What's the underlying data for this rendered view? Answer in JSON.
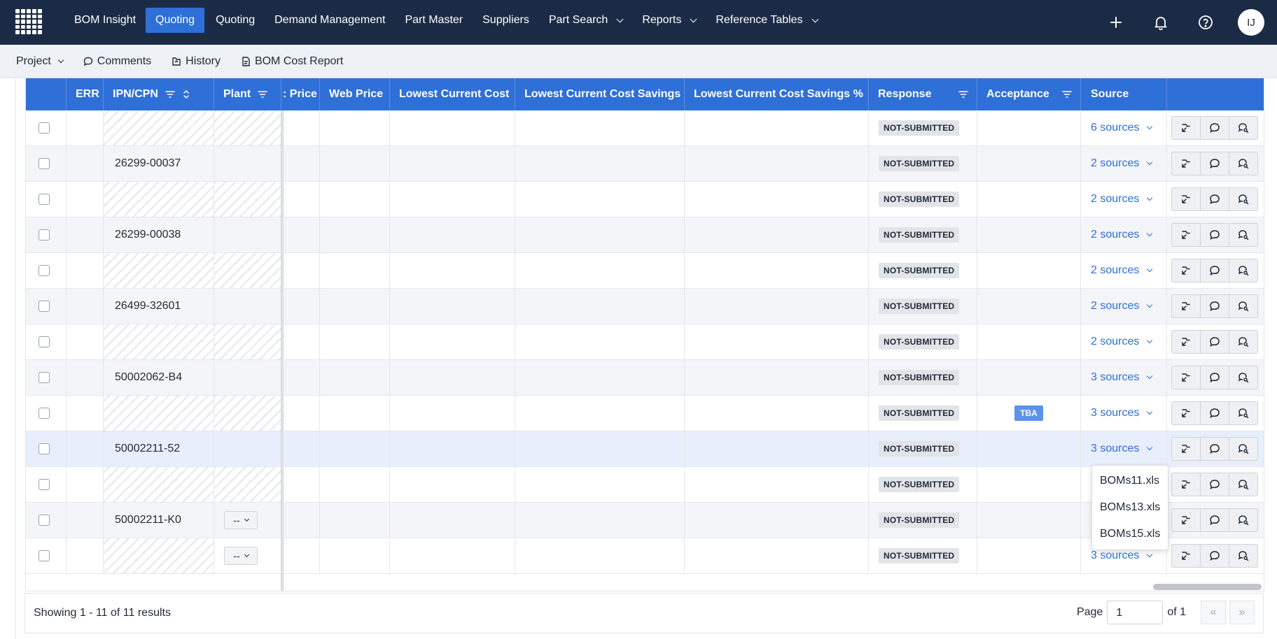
{
  "nav": {
    "items": [
      {
        "label": "BOM Insight",
        "active": false,
        "has_menu": false
      },
      {
        "label": "Quoting",
        "active": true,
        "has_menu": false
      },
      {
        "label": "Quoting",
        "active": false,
        "has_menu": false
      },
      {
        "label": "Demand Management",
        "active": false,
        "has_menu": false
      },
      {
        "label": "Part Master",
        "active": false,
        "has_menu": false
      },
      {
        "label": "Suppliers",
        "active": false,
        "has_menu": false
      },
      {
        "label": "Part Search",
        "active": false,
        "has_menu": true
      },
      {
        "label": "Reports",
        "active": false,
        "has_menu": true
      },
      {
        "label": "Reference Tables",
        "active": false,
        "has_menu": true
      }
    ],
    "avatar_initials": "IJ",
    "icons": [
      "plus-icon",
      "bell-icon",
      "help-icon"
    ]
  },
  "subnav": {
    "project": "Project",
    "comments": "Comments",
    "history": "History",
    "bom_cost_report": "BOM Cost Report"
  },
  "table": {
    "headers": {
      "err": "ERR",
      "ipn": "IPN/CPN",
      "plant": "Plant",
      "price": ": Price",
      "web_price": "Web Price",
      "lowest_cost": "Lowest Current Cost",
      "lowest_savings": "Lowest Current Cost Savings",
      "lowest_savings_pct": "Lowest Current Cost Savings %",
      "response": "Response",
      "acceptance": "Acceptance",
      "source": "Source"
    },
    "rows": [
      {
        "ipn": "",
        "plant": "",
        "response": "NOT-SUBMITTED",
        "acceptance": "",
        "source": "6 sources"
      },
      {
        "ipn": "26299-00037",
        "plant": "",
        "response": "NOT-SUBMITTED",
        "acceptance": "",
        "source": "2 sources"
      },
      {
        "ipn": "",
        "plant": "",
        "response": "NOT-SUBMITTED",
        "acceptance": "",
        "source": "2 sources"
      },
      {
        "ipn": "26299-00038",
        "plant": "",
        "response": "NOT-SUBMITTED",
        "acceptance": "",
        "source": "2 sources"
      },
      {
        "ipn": "",
        "plant": "",
        "response": "NOT-SUBMITTED",
        "acceptance": "",
        "source": "2 sources"
      },
      {
        "ipn": "26499-32601",
        "plant": "",
        "response": "NOT-SUBMITTED",
        "acceptance": "",
        "source": "2 sources"
      },
      {
        "ipn": "",
        "plant": "",
        "response": "NOT-SUBMITTED",
        "acceptance": "",
        "source": "2 sources"
      },
      {
        "ipn": "50002062-B4",
        "plant": "",
        "response": "NOT-SUBMITTED",
        "acceptance": "",
        "source": "3 sources"
      },
      {
        "ipn": "",
        "plant": "",
        "response": "NOT-SUBMITTED",
        "acceptance": "TBA",
        "source": "3 sources"
      },
      {
        "ipn": "50002211-52",
        "plant": "",
        "response": "NOT-SUBMITTED",
        "acceptance": "",
        "source": "3 sources"
      },
      {
        "ipn": "",
        "plant": "",
        "response": "NOT-SUBMITTED",
        "acceptance": "",
        "source": ""
      },
      {
        "ipn": "50002211-K0",
        "plant": "--",
        "response": "NOT-SUBMITTED",
        "acceptance": "",
        "source": ""
      },
      {
        "ipn": "",
        "plant": "--",
        "response": "NOT-SUBMITTED",
        "acceptance": "",
        "source": "3 sources"
      }
    ]
  },
  "source_dropdown": {
    "options": [
      "BOMs11.xls",
      "BOMs13.xls",
      "BOMs15.xls"
    ]
  },
  "footer": {
    "showing": "Showing 1 - 11 of 11 results",
    "page_label": "Page",
    "page_value": "1",
    "of_label": "of 1",
    "prev": "«",
    "next": "»"
  },
  "colors": {
    "nav_bg": "#1c2b45",
    "accent": "#2f6fd8",
    "tba": "#5b93ea"
  }
}
